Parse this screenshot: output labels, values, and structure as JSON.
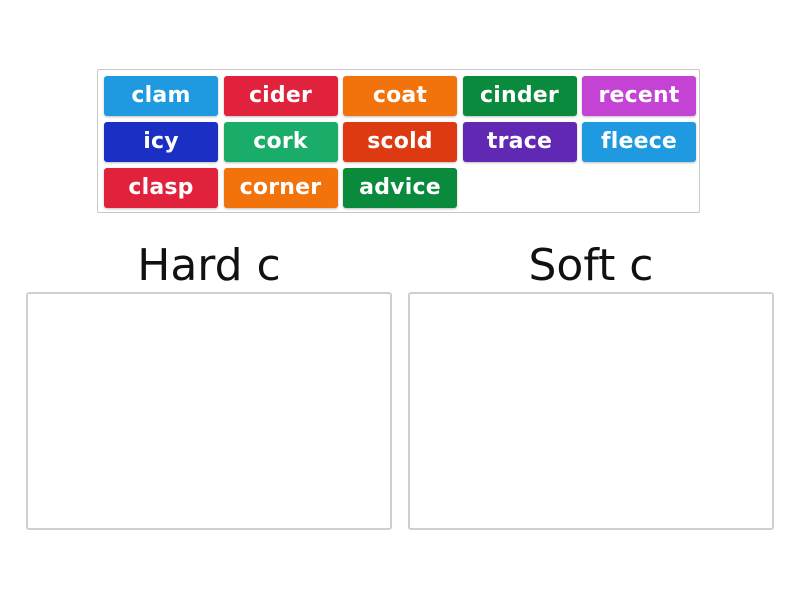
{
  "activity": {
    "type": "group-sort",
    "tiles": [
      {
        "label": "clam",
        "color": "#1f9ae0"
      },
      {
        "label": "cider",
        "color": "#e0223d"
      },
      {
        "label": "coat",
        "color": "#f2720c"
      },
      {
        "label": "cinder",
        "color": "#0a8a3c"
      },
      {
        "label": "recent",
        "color": "#c443d4"
      },
      {
        "label": "icy",
        "color": "#1b2fc4"
      },
      {
        "label": "cork",
        "color": "#1aad6a"
      },
      {
        "label": "scold",
        "color": "#dd3a12"
      },
      {
        "label": "trace",
        "color": "#6128b4"
      },
      {
        "label": "fleece",
        "color": "#1f9ae0"
      },
      {
        "label": "clasp",
        "color": "#e0223d"
      },
      {
        "label": "corner",
        "color": "#f2720c"
      },
      {
        "label": "advice",
        "color": "#0a8a3c"
      }
    ],
    "groups": [
      {
        "title": "Hard c",
        "items": []
      },
      {
        "title": "Soft c",
        "items": []
      }
    ]
  }
}
